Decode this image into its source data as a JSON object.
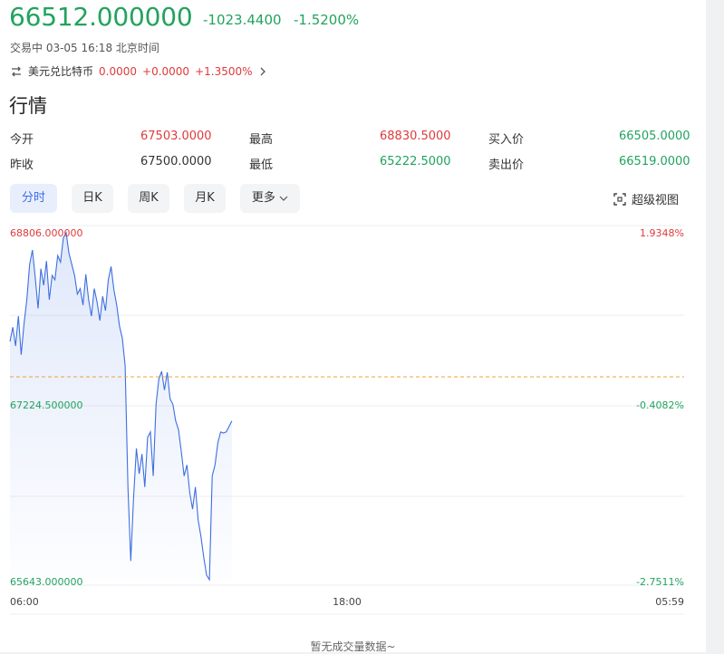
{
  "header": {
    "price": "66512.000000",
    "change": "-1023.4400",
    "change_pct": "-1.5200%",
    "status": "交易中 03-05 16:18 北京时间"
  },
  "related": {
    "icon": "swap-icon",
    "name": "美元兑比特币",
    "price": "0.0000",
    "change": "+0.0000",
    "change_pct": "+1.3500%"
  },
  "section_title": "行情",
  "quote": {
    "open_label": "今开",
    "open": "67503.0000",
    "high_label": "最高",
    "high": "68830.5000",
    "bid_label": "买入价",
    "bid": "66505.0000",
    "prev_close_label": "昨收",
    "prev_close": "67500.0000",
    "low_label": "最低",
    "low": "65222.5000",
    "ask_label": "卖出价",
    "ask": "66519.0000"
  },
  "colors": {
    "up": "#e03a3a",
    "down": "#21a35e",
    "line": "#3d6fe0",
    "ref": "#f0a040",
    "active_tab": "#3b6ee8"
  },
  "tabs": [
    {
      "label": "分时",
      "active": true
    },
    {
      "label": "日K",
      "active": false
    },
    {
      "label": "周K",
      "active": false
    },
    {
      "label": "月K",
      "active": false
    },
    {
      "label": "更多",
      "active": false
    }
  ],
  "super_view_label": "超级视图",
  "chart_data": {
    "type": "area",
    "y_left_ticks": [
      "68806.000000",
      "67224.500000",
      "65643.000000"
    ],
    "y_right_ticks": [
      "1.9348%",
      "-0.4082%",
      "-2.7511%"
    ],
    "x_ticks": [
      "06:00",
      "18:00",
      "05:59"
    ],
    "y_range": [
      65643,
      68806
    ],
    "reference": 67500,
    "x": [
      0,
      2,
      4,
      6,
      8,
      10,
      12,
      14,
      16,
      18,
      20,
      22,
      24,
      26,
      28,
      30,
      32,
      34,
      36,
      38,
      40,
      42,
      44,
      46,
      48,
      50,
      52,
      54,
      56,
      58,
      60,
      62,
      64,
      66,
      68,
      70,
      72,
      74,
      76,
      78,
      80,
      82,
      84,
      86,
      88,
      90,
      92,
      94,
      96,
      98,
      100,
      102,
      104,
      106,
      108,
      110,
      112,
      114,
      116,
      118,
      120,
      122,
      124,
      126,
      128,
      130,
      132,
      134,
      136,
      138,
      140,
      142,
      144,
      146,
      148,
      150,
      152,
      154,
      156,
      158
    ],
    "values": [
      67820,
      67950,
      67780,
      68050,
      67700,
      67980,
      68200,
      68520,
      68650,
      68400,
      68120,
      68480,
      68330,
      68550,
      68200,
      68420,
      68380,
      68600,
      68540,
      68760,
      68806,
      68620,
      68520,
      68420,
      68250,
      68300,
      68150,
      68430,
      68200,
      68050,
      68300,
      68180,
      68010,
      68230,
      68100,
      68380,
      68500,
      68290,
      68150,
      67960,
      67850,
      67600,
      66500,
      65830,
      66400,
      66850,
      66620,
      66800,
      66500,
      66950,
      67000,
      66600,
      67250,
      67480,
      67550,
      67380,
      67540,
      67300,
      67250,
      67100,
      67020,
      66820,
      66600,
      66700,
      66450,
      66300,
      66500,
      66200,
      66050,
      65860,
      65700,
      65660,
      66600,
      66700,
      66900,
      67000,
      66990,
      67000,
      67050,
      67100
    ],
    "ylabel": "",
    "xlabel": ""
  },
  "empty_volume_msg": "暂无成交量数据~"
}
